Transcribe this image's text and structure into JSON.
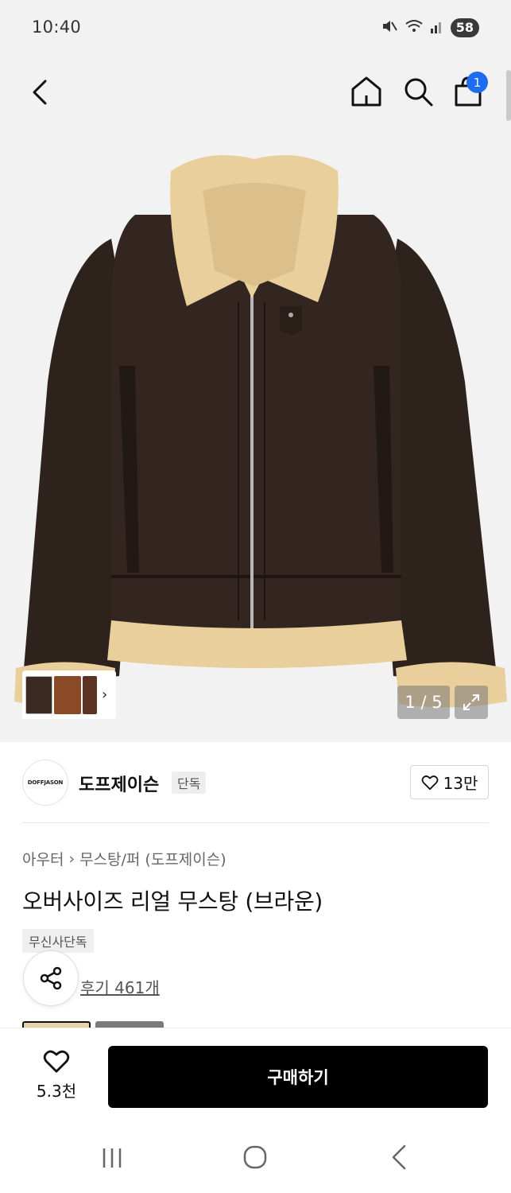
{
  "status_bar": {
    "time": "10:40",
    "battery": "58",
    "icons": [
      "mute-icon",
      "wifi-icon",
      "signal-icon"
    ]
  },
  "header": {
    "icons": [
      "back-icon",
      "home-icon",
      "search-icon",
      "cart-icon"
    ],
    "cart_badge": "1"
  },
  "gallery": {
    "counter": "1 / 5",
    "thumb_colors": [
      "#3a2a22",
      "#8a4a26",
      "#5a3322"
    ],
    "icons": [
      "chevron-right-icon",
      "expand-icon"
    ]
  },
  "brand": {
    "logo_text": "DOFFJASON",
    "name": "도프제이슨",
    "badge": "단독",
    "like_count": "13만"
  },
  "product": {
    "breadcrumb": [
      "아우터",
      "무스탕/퍼 (도프제이슨)"
    ],
    "title": "오버사이즈 리얼 무스탕 (브라운)",
    "tag": "무신사단독",
    "reviews": "후기 461개",
    "swatch_colors": [
      "#e7d3ad",
      "#7a7a7a"
    ]
  },
  "purchase": {
    "wish_count": "5.3천",
    "buy_label": "구매하기"
  },
  "colors": {
    "accent_badge": "#1e6cf0",
    "buy_button": "#000000",
    "jacket_leather": "#2e221d",
    "jacket_fur": "#e9cf9c"
  }
}
